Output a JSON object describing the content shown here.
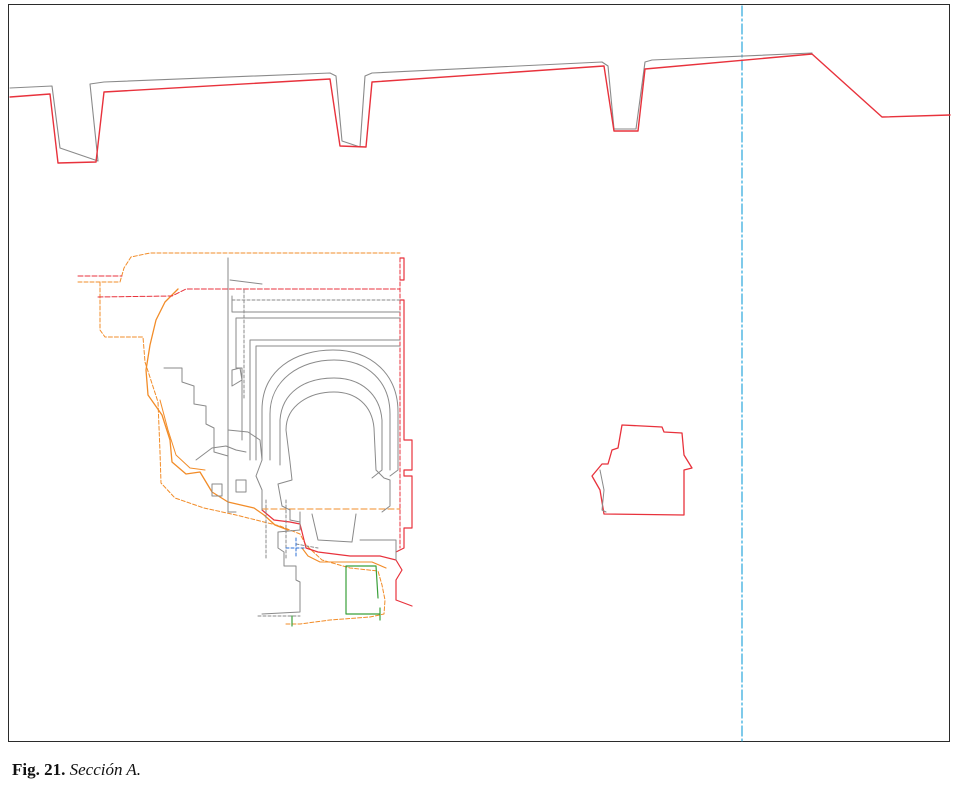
{
  "figure": {
    "label": "Fig. 21.",
    "title": "Sección A."
  },
  "colors": {
    "section_line": "#e8323c",
    "projection_line": "#8a8a8a",
    "orange_line": "#f28c28",
    "green_line": "#3aa03a",
    "axis_line": "#2aa7dd",
    "blue_line": "#2b6fd6",
    "frame": "#2b2b2b"
  }
}
